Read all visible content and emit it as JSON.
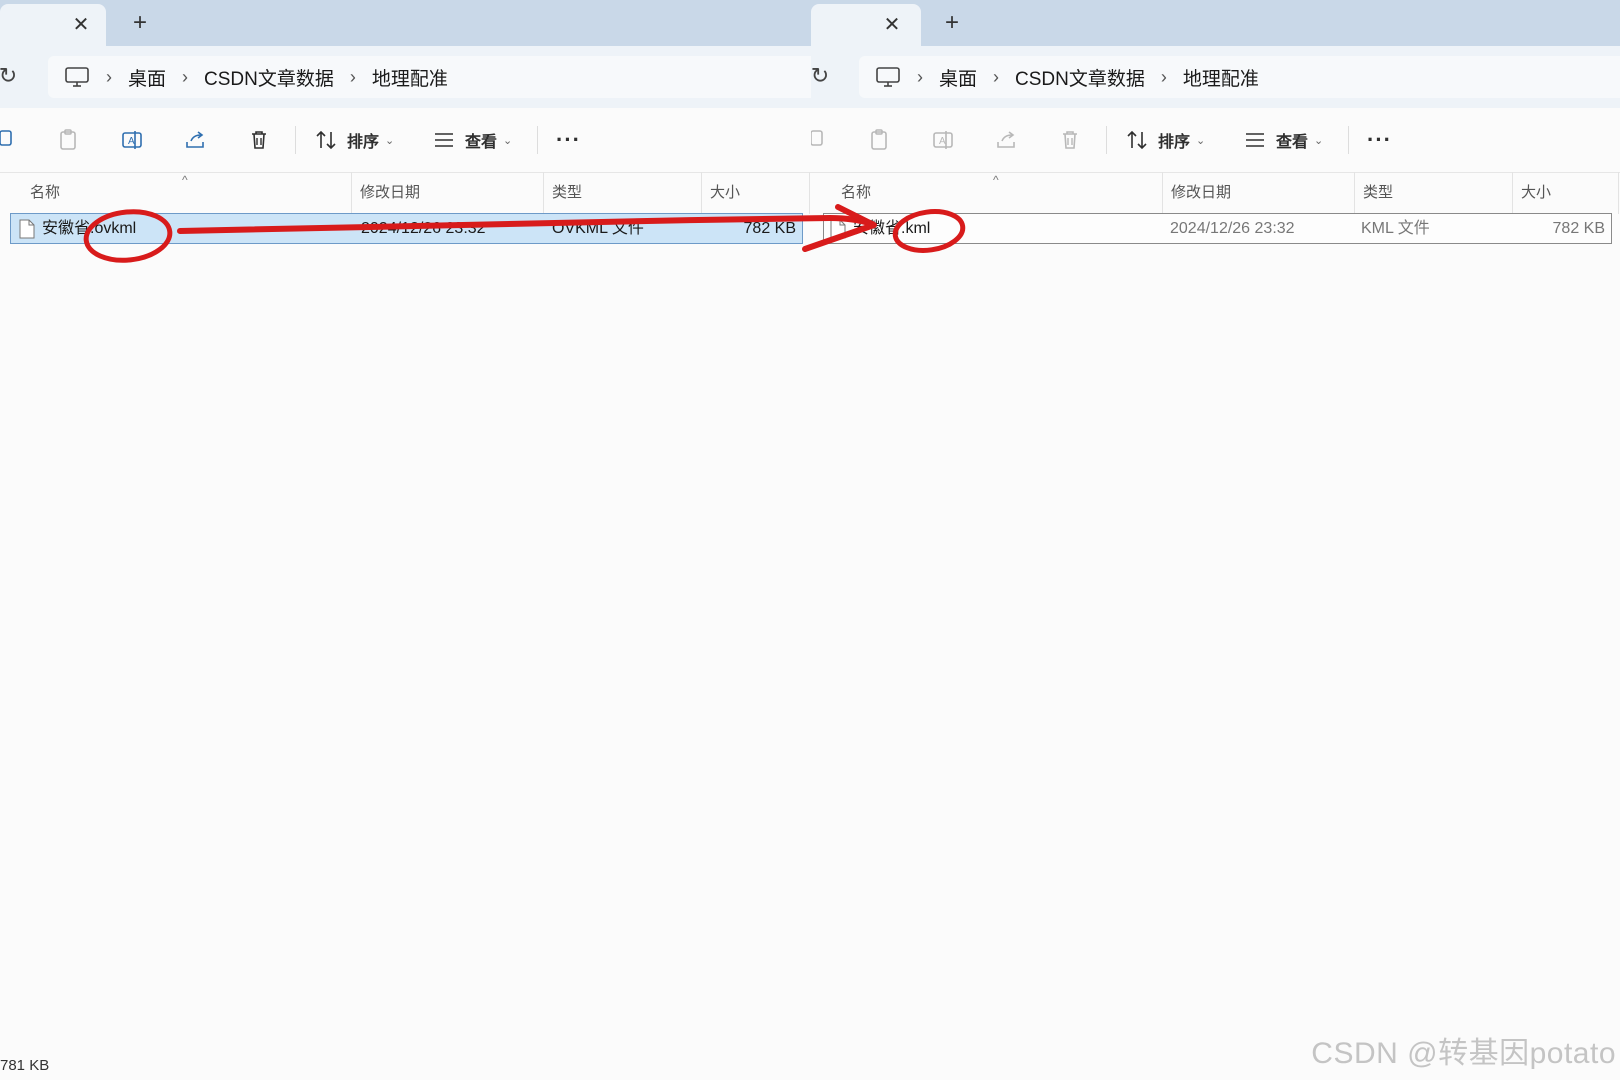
{
  "panes": [
    {
      "id": "left",
      "breadcrumb": [
        "桌面",
        "CSDN文章数据",
        "地理配准"
      ],
      "toolbar": {
        "sort_label": "排序",
        "view_label": "查看"
      },
      "columns": {
        "name": "名称",
        "modified": "修改日期",
        "type": "类型",
        "size": "大小"
      },
      "file": {
        "name": "安徽省.ovkml",
        "modified": "2024/12/26 23:32",
        "type": "OVKML 文件",
        "size": "782 KB"
      },
      "status": "781 KB"
    },
    {
      "id": "right",
      "breadcrumb": [
        "桌面",
        "CSDN文章数据",
        "地理配准"
      ],
      "toolbar": {
        "sort_label": "排序",
        "view_label": "查看"
      },
      "columns": {
        "name": "名称",
        "modified": "修改日期",
        "type": "类型",
        "size": "大小"
      },
      "file": {
        "name": "安徽省.kml",
        "modified": "2024/12/26 23:32",
        "type": "KML 文件",
        "size": "782 KB"
      }
    }
  ],
  "watermark": "CSDN @转基因potato",
  "colors": {
    "annotation": "#d81b1b",
    "selection": "#cce4f7",
    "tabbar": "#c9d8e8"
  },
  "icons": [
    "close-icon",
    "plus-icon",
    "refresh-icon",
    "computer-icon",
    "chevron-right-icon",
    "copy-icon",
    "paste-icon",
    "rename-icon",
    "share-icon",
    "delete-icon",
    "sort-icon",
    "view-icon",
    "more-icon",
    "file-icon"
  ]
}
